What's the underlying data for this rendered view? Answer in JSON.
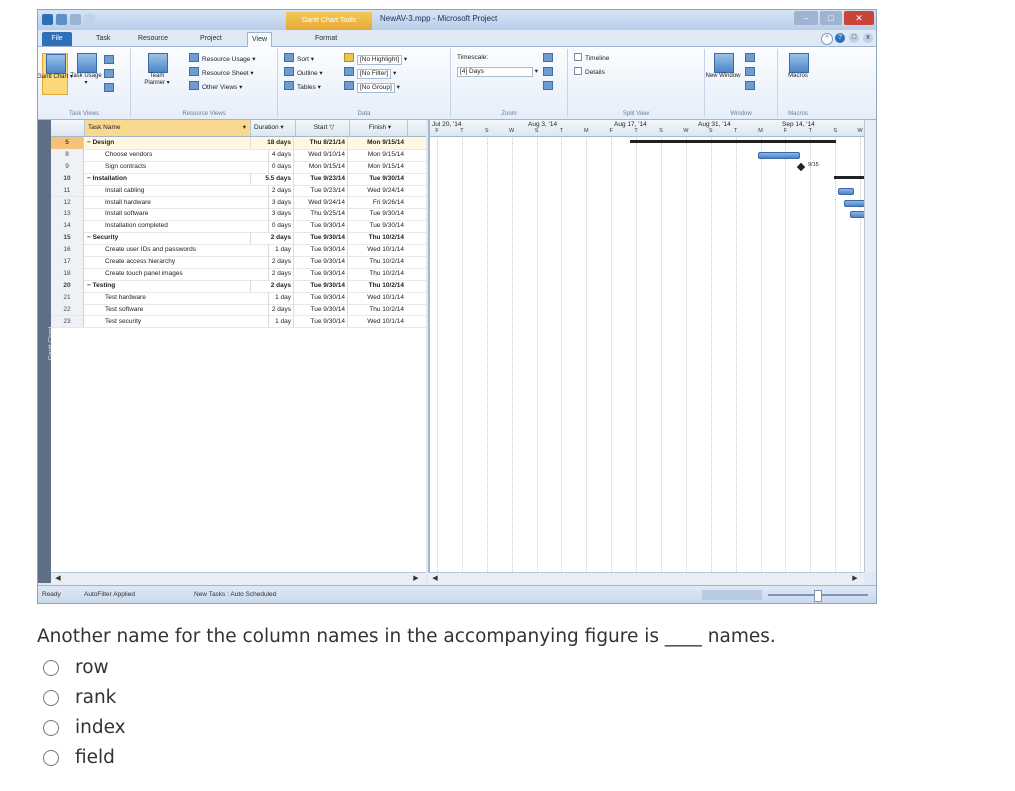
{
  "window": {
    "title": "NewAV-3.mpp - Microsoft Project",
    "context_tab": "Gantt Chart Tools",
    "tabs": [
      "File",
      "Task",
      "Resource",
      "Project",
      "View",
      "Format"
    ],
    "active_tab": "View"
  },
  "ribbon": {
    "task_views": {
      "gantt": "Gantt Chart ▾",
      "task_usage": "Task Usage ▾",
      "label": "Task Views"
    },
    "resource_views": {
      "team_planner": "Team Planner ▾",
      "resource_usage": "Resource Usage ▾",
      "resource_sheet": "Resource Sheet ▾",
      "other_views": "Other Views ▾",
      "label": "Resource Views"
    },
    "data": {
      "sort": "Sort ▾",
      "outline": "Outline ▾",
      "tables": "Tables ▾",
      "highlight": "[No Highlight]",
      "filter": "[No Filter]",
      "group": "[No Group]",
      "label": "Data"
    },
    "zoom": {
      "timescale": "Timescale:",
      "timescale_value": "[4] Days",
      "label": "Zoom"
    },
    "split_view": {
      "timeline": "Timeline",
      "details": "Details",
      "label": "Split View"
    },
    "window": {
      "new_window": "New Window",
      "label": "Window"
    },
    "macros": {
      "macros": "Macros",
      "label": "Macros"
    }
  },
  "side_label": "Gantt Chart",
  "table": {
    "headers": {
      "name": "Task Name",
      "duration": "Duration",
      "start": "Start",
      "finish": "Finish"
    },
    "rows": [
      {
        "id": "5",
        "name": "Design",
        "duration": "18 days",
        "start": "Thu 8/21/14",
        "finish": "Mon 9/15/14",
        "summary": true,
        "indent": 0
      },
      {
        "id": "8",
        "name": "Choose vendors",
        "duration": "4 days",
        "start": "Wed 9/10/14",
        "finish": "Mon 9/15/14",
        "summary": false,
        "indent": 1
      },
      {
        "id": "9",
        "name": "Sign contracts",
        "duration": "0 days",
        "start": "Mon 9/15/14",
        "finish": "Mon 9/15/14",
        "summary": false,
        "indent": 1
      },
      {
        "id": "10",
        "name": "Installation",
        "duration": "5.5 days",
        "start": "Tue 9/23/14",
        "finish": "Tue 9/30/14",
        "summary": true,
        "indent": 0
      },
      {
        "id": "11",
        "name": "Install cabling",
        "duration": "2 days",
        "start": "Tue 9/23/14",
        "finish": "Wed 9/24/14",
        "summary": false,
        "indent": 1
      },
      {
        "id": "12",
        "name": "Install hardware",
        "duration": "3 days",
        "start": "Wed 9/24/14",
        "finish": "Fri 9/26/14",
        "summary": false,
        "indent": 1
      },
      {
        "id": "13",
        "name": "Install software",
        "duration": "3 days",
        "start": "Thu 9/25/14",
        "finish": "Tue 9/30/14",
        "summary": false,
        "indent": 1
      },
      {
        "id": "14",
        "name": "Installation completed",
        "duration": "0 days",
        "start": "Tue 9/30/14",
        "finish": "Tue 9/30/14",
        "summary": false,
        "indent": 1
      },
      {
        "id": "15",
        "name": "Security",
        "duration": "2 days",
        "start": "Tue 9/30/14",
        "finish": "Thu 10/2/14",
        "summary": true,
        "indent": 0
      },
      {
        "id": "16",
        "name": "Create user IDs and passwords",
        "duration": "1 day",
        "start": "Tue 9/30/14",
        "finish": "Wed 10/1/14",
        "summary": false,
        "indent": 1
      },
      {
        "id": "17",
        "name": "Create access hierarchy",
        "duration": "2 days",
        "start": "Tue 9/30/14",
        "finish": "Thu 10/2/14",
        "summary": false,
        "indent": 1
      },
      {
        "id": "18",
        "name": "Create touch panel images",
        "duration": "2 days",
        "start": "Tue 9/30/14",
        "finish": "Thu 10/2/14",
        "summary": false,
        "indent": 1
      },
      {
        "id": "20",
        "name": "Testing",
        "duration": "2 days",
        "start": "Tue 9/30/14",
        "finish": "Thu 10/2/14",
        "summary": true,
        "indent": 0
      },
      {
        "id": "21",
        "name": "Test hardware",
        "duration": "1 day",
        "start": "Tue 9/30/14",
        "finish": "Wed 10/1/14",
        "summary": false,
        "indent": 1
      },
      {
        "id": "22",
        "name": "Test software",
        "duration": "2 days",
        "start": "Tue 9/30/14",
        "finish": "Thu 10/2/14",
        "summary": false,
        "indent": 1
      },
      {
        "id": "23",
        "name": "Test security",
        "duration": "1 day",
        "start": "Tue 9/30/14",
        "finish": "Wed 10/1/14",
        "summary": false,
        "indent": 1
      }
    ]
  },
  "timescale": {
    "weeks": [
      "Jul 20, '14",
      "Aug 3, '14",
      "Aug 17, '14",
      "Aug 31, '14",
      "Sep 14, '14"
    ],
    "day_letters": [
      "F",
      "T",
      "S",
      "W",
      "S",
      "T",
      "M",
      "F",
      "T",
      "S",
      "W",
      "S",
      "T",
      "M",
      "F",
      "T",
      "S",
      "W"
    ],
    "milestone_label": "9/15"
  },
  "statusbar": {
    "ready": "Ready",
    "filter": "AutoFilter Applied",
    "new_tasks": "New Tasks : Auto Scheduled"
  },
  "question": {
    "text": "Another name for the column names in the accompanying figure is ____ names.",
    "options": [
      "row",
      "rank",
      "index",
      "field"
    ]
  }
}
